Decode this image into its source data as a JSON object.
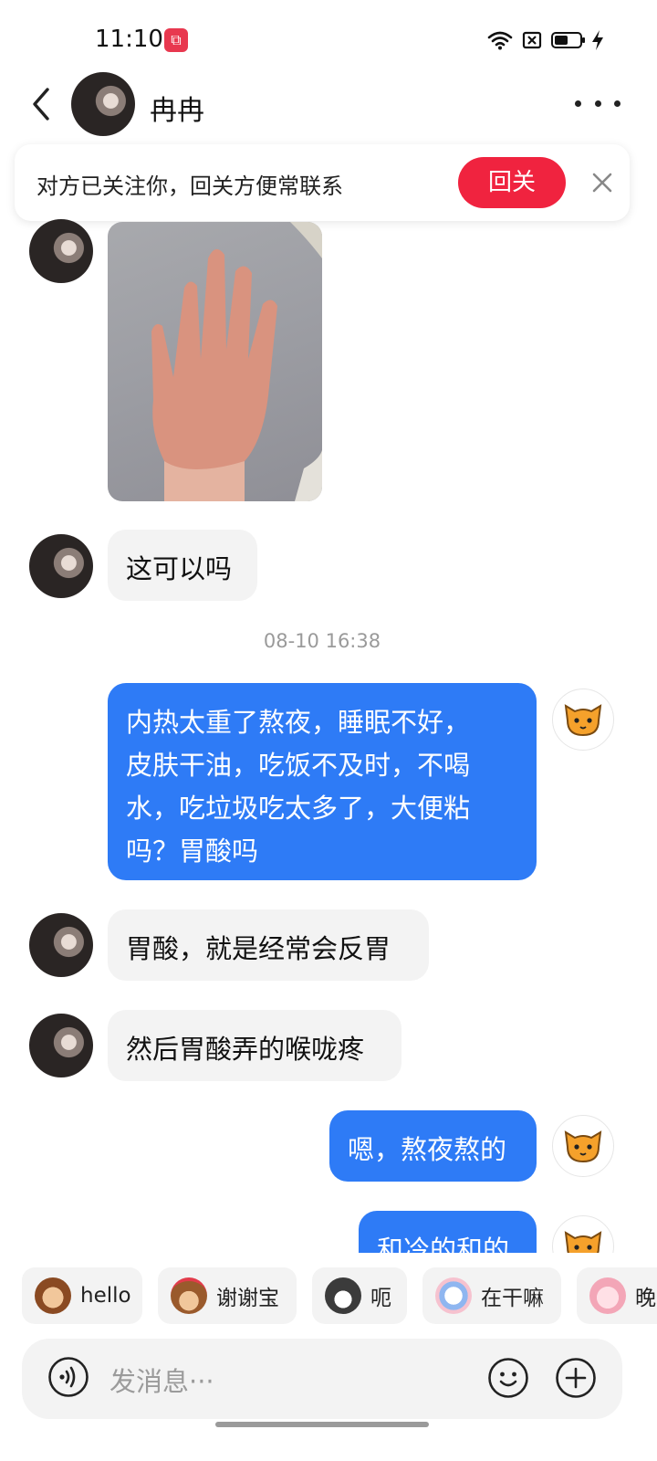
{
  "status_bar": {
    "time": "11:10",
    "icons": [
      "app-record-icon",
      "wifi-icon",
      "sim-off-icon",
      "battery-icon",
      "charging-icon"
    ]
  },
  "header": {
    "contact_name": "冉冉",
    "icons": [
      "back-icon",
      "more-icon"
    ]
  },
  "follow_banner": {
    "text": "对方已关注你，回关方便常联系",
    "button": "回关",
    "accent": "#f0233f"
  },
  "messages": [
    {
      "side": "left",
      "type": "image",
      "alt_icon": "hand-photo"
    },
    {
      "side": "left",
      "type": "text",
      "lines": [
        "这可以吗"
      ]
    },
    {
      "type": "timestamp",
      "text": "08-10 16:38"
    },
    {
      "side": "right",
      "type": "text",
      "lines": [
        "内热太重了熬夜，睡眠不好，",
        "皮肤干油，吃饭不及时，不喝",
        "水，吃垃圾吃太多了，大便粘",
        "吗？胃酸吗"
      ]
    },
    {
      "side": "left",
      "type": "text",
      "lines": [
        "胃酸，就是经常会反胃"
      ]
    },
    {
      "side": "left",
      "type": "text",
      "lines": [
        "然后胃酸弄的喉咙疼"
      ]
    },
    {
      "side": "right",
      "type": "text",
      "lines": [
        "嗯，熬夜熬的"
      ]
    },
    {
      "side": "right",
      "type": "text",
      "lines": [
        "和冷的和的"
      ]
    }
  ],
  "quick_replies": [
    {
      "label": "hello",
      "icon": "monkey-sticker-icon"
    },
    {
      "label": "谢谢宝",
      "icon": "monkey-flower-sticker-icon"
    },
    {
      "label": "呃",
      "icon": "cat-sticker-icon"
    },
    {
      "label": "在干嘛",
      "icon": "cartoon-sticker-icon"
    },
    {
      "label": "晚",
      "icon": "pig-sticker-icon"
    }
  ],
  "input": {
    "placeholder": "发消息···"
  },
  "colors": {
    "outgoing_bubble": "#2e7bf6",
    "incoming_bubble": "#f3f3f3",
    "follow_button": "#f0233f"
  }
}
